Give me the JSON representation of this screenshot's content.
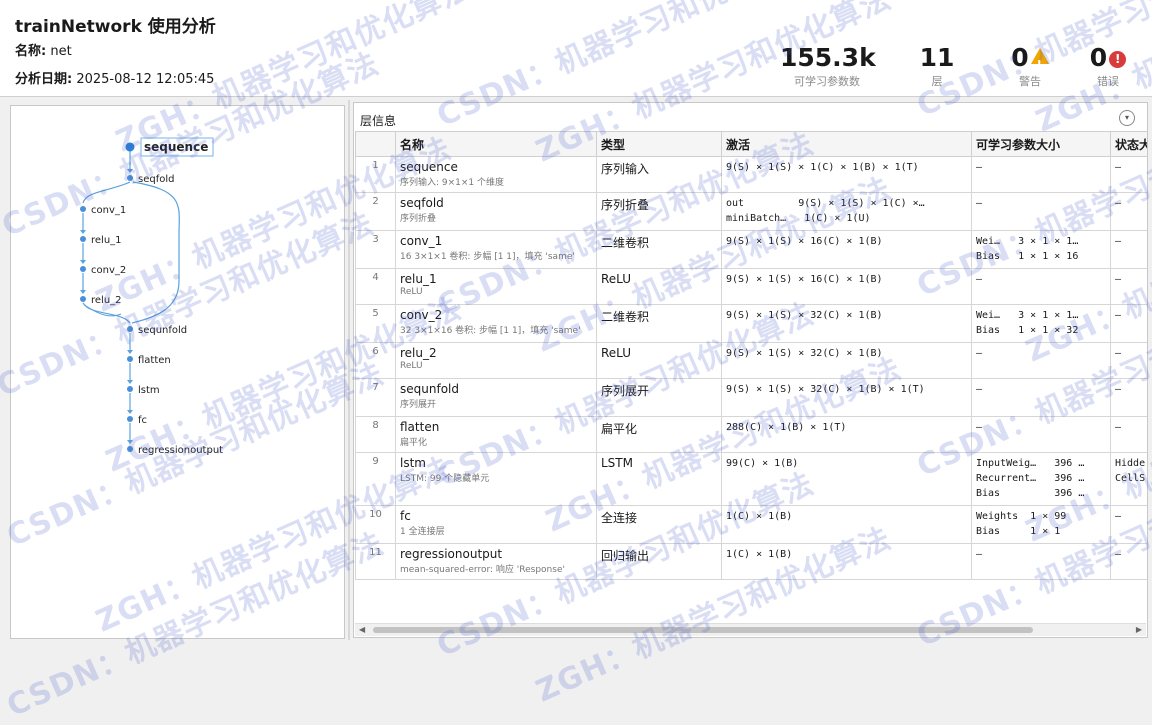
{
  "header": {
    "title": "trainNetwork 使用分析",
    "name_label": "名称:",
    "name_value": "net",
    "date_label": "分析日期:",
    "date_value": "2025-08-12 12:05:45"
  },
  "stats": {
    "params": {
      "value": "155.3k",
      "label": "可学习参数数"
    },
    "layers": {
      "value": "11",
      "label": "层"
    },
    "warnings": {
      "value": "0",
      "label": "警告",
      "icon": "warning-icon"
    },
    "errors": {
      "value": "0",
      "label": "错误",
      "icon": "error-icon"
    }
  },
  "graph": {
    "nodes": [
      "sequence",
      "seqfold",
      "conv_1",
      "relu_1",
      "conv_2",
      "relu_2",
      "sequnfold",
      "flatten",
      "lstm",
      "fc",
      "regressionoutput"
    ],
    "selected": "sequence"
  },
  "panel": {
    "title": "层信息",
    "columns": [
      "",
      "名称",
      "类型",
      "激活",
      "可学习参数大小",
      "状态大小"
    ]
  },
  "rows": [
    {
      "idx": "1",
      "name": "sequence",
      "desc": "序列输入: 9×1×1 个维度",
      "type": "序列输入",
      "act": [
        "9(S) × 1(S) × 1(C) × 1(B) × 1(T)"
      ],
      "learn": [
        "–"
      ],
      "state": [
        "–"
      ]
    },
    {
      "idx": "2",
      "name": "seqfold",
      "desc": "序列折叠",
      "type": "序列折叠",
      "act": [
        "out         9(S) × 1(S) × 1(C) ×…",
        "miniBatch…   1(C) × 1(U)"
      ],
      "learn": [
        "–"
      ],
      "state": [
        "–"
      ]
    },
    {
      "idx": "3",
      "name": "conv_1",
      "desc": "16 3×1×1 卷积: 步幅 [1 1]，填充 'same'",
      "type": "二维卷积",
      "act": [
        "9(S) × 1(S) × 16(C) × 1(B)"
      ],
      "learn": [
        "Wei…   3 × 1 × 1…",
        "Bias   1 × 1 × 16"
      ],
      "state": [
        "–"
      ]
    },
    {
      "idx": "4",
      "name": "relu_1",
      "desc": "ReLU",
      "type": "ReLU",
      "act": [
        "9(S) × 1(S) × 16(C) × 1(B)"
      ],
      "learn": [
        "–"
      ],
      "state": [
        "–"
      ]
    },
    {
      "idx": "5",
      "name": "conv_2",
      "desc": "32 3×1×16 卷积: 步幅 [1 1]，填充 'same'",
      "type": "二维卷积",
      "act": [
        "9(S) × 1(S) × 32(C) × 1(B)"
      ],
      "learn": [
        "Wei…   3 × 1 × 1…",
        "Bias   1 × 1 × 32"
      ],
      "state": [
        "–"
      ]
    },
    {
      "idx": "6",
      "name": "relu_2",
      "desc": "ReLU",
      "type": "ReLU",
      "act": [
        "9(S) × 1(S) × 32(C) × 1(B)"
      ],
      "learn": [
        "–"
      ],
      "state": [
        "–"
      ]
    },
    {
      "idx": "7",
      "name": "sequnfold",
      "desc": "序列展开",
      "type": "序列展开",
      "act": [
        "9(S) × 1(S) × 32(C) × 1(B) × 1(T)"
      ],
      "learn": [
        "–"
      ],
      "state": [
        "–"
      ]
    },
    {
      "idx": "8",
      "name": "flatten",
      "desc": "扁平化",
      "type": "扁平化",
      "act": [
        "288(C) × 1(B) × 1(T)"
      ],
      "learn": [
        "–"
      ],
      "state": [
        "–"
      ]
    },
    {
      "idx": "9",
      "name": "lstm",
      "desc": "LSTM: 99 个隐藏单元",
      "type": "LSTM",
      "act": [
        "99(C) × 1(B)"
      ],
      "learn": [
        "InputWeig…   396 …",
        "Recurrent…   396 …",
        "Bias         396 …"
      ],
      "state": [
        "Hidde",
        "CellS"
      ]
    },
    {
      "idx": "10",
      "name": "fc",
      "desc": "1 全连接层",
      "type": "全连接",
      "act": [
        "1(C) × 1(B)"
      ],
      "learn": [
        "Weights  1 × 99",
        "Bias     1 × 1"
      ],
      "state": [
        "–"
      ]
    },
    {
      "idx": "11",
      "name": "regressionoutput",
      "desc": "mean-squared-error: 响应 'Response'",
      "type": "回归输出",
      "act": [
        "1(C) × 1(B)"
      ],
      "learn": [
        "–"
      ],
      "state": [
        "–"
      ]
    }
  ],
  "watermarks": [
    "ZGH：机器学习和优化算法",
    "CSDN：机器学习和优化算法"
  ]
}
